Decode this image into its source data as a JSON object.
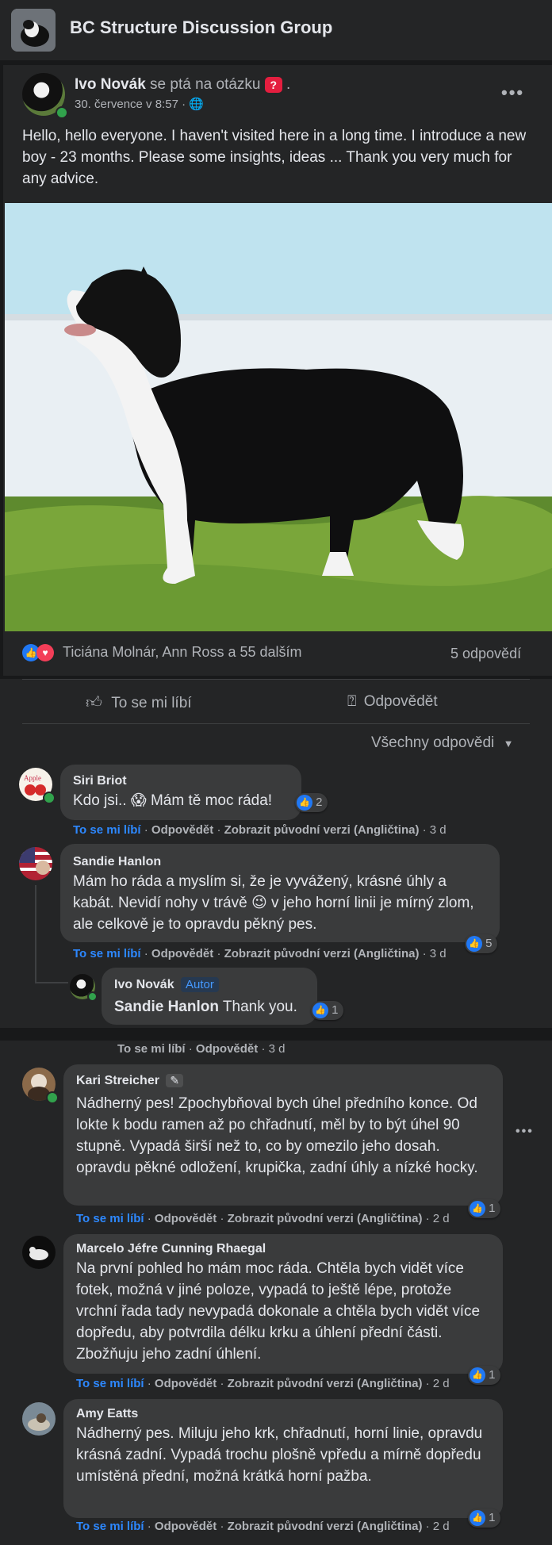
{
  "group": {
    "title": "BC Structure Discussion Group"
  },
  "post": {
    "author": "Ivo Novák",
    "action": "se ptá na otázku",
    "date": "30. července v 8:57 ·",
    "text": "Hello, hello everyone. I haven't visited here in a long time. I introduce a new boy - 23 months. Please some insights, ideas ... Thank you very much for any advice.",
    "reactions_text": "Ticiána Molnár, Ann Ross a 55 dalším",
    "answers_count": "5 odpovědí"
  },
  "actions": {
    "like": "To se mi líbí",
    "answer": "Odpovědět"
  },
  "sort": {
    "label": "Všechny odpovědi"
  },
  "meta_labels": {
    "like": "To se mi líbí",
    "reply": "Odpovědět",
    "translate": "Zobrazit původní verzi (Angličtina)",
    "sep": "·"
  },
  "comments": [
    {
      "name": "Siri Briot",
      "text": "Kdo jsi.. 😱 Mám tě moc ráda!",
      "reactions": "2",
      "time": "3 d"
    },
    {
      "name": "Sandie Hanlon",
      "text": "Mám ho ráda a myslím si, že je vyvážený, krásné úhly a kabát. Nevidí nohy v trávě 😉 v jeho horní linii je mírný zlom, ale celkově je to opravdu pěkný pes.",
      "reactions": "5",
      "time": "3 d"
    },
    {
      "name": "Ivo Novák",
      "badge": "Autor",
      "mention": "Sandie Hanlon",
      "text": "Thank you.",
      "reactions": "1",
      "time": "3 d"
    },
    {
      "name": "Kari Streicher",
      "text": "Nádherný pes! Zpochybňoval bych úhel předního konce. Od lokte k bodu ramen až po chřadnutí, měl by to být úhel 90 stupně. Vypadá širší než to, co by omezilo jeho dosah. opravdu pěkné odložení, krupička, zadní úhly a nízké hocky.",
      "reactions": "1",
      "time": "2 d"
    },
    {
      "name": "Marcelo Jéfre Cunning Rhaegal",
      "text": "Na první pohled ho mám moc ráda. Chtěla bych vidět více fotek, možná v jiné poloze, vypadá to ještě lépe, protože vrchní řada tady nevypadá dokonale a chtěla bych vidět více dopředu, aby potvrdila délku krku a úhlení přední části. Zbožňuju jeho zadní úhlení.",
      "reactions": "1",
      "time": "2 d"
    },
    {
      "name": "Amy Eatts",
      "text": "Nádherný pes. Miluju jeho krk, chřadnutí, horní linie, opravdu krásná zadní. Vypadá trochu plošně vpředu a mírně dopředu umístěná přední, možná krátká horní pažba.",
      "reactions": "1",
      "time": "2 d"
    }
  ],
  "icons": {
    "more": "more-dots-icon",
    "like": "thumbs-up-icon",
    "answer": "question-bubble-icon",
    "sort": "chevron-down-icon"
  }
}
